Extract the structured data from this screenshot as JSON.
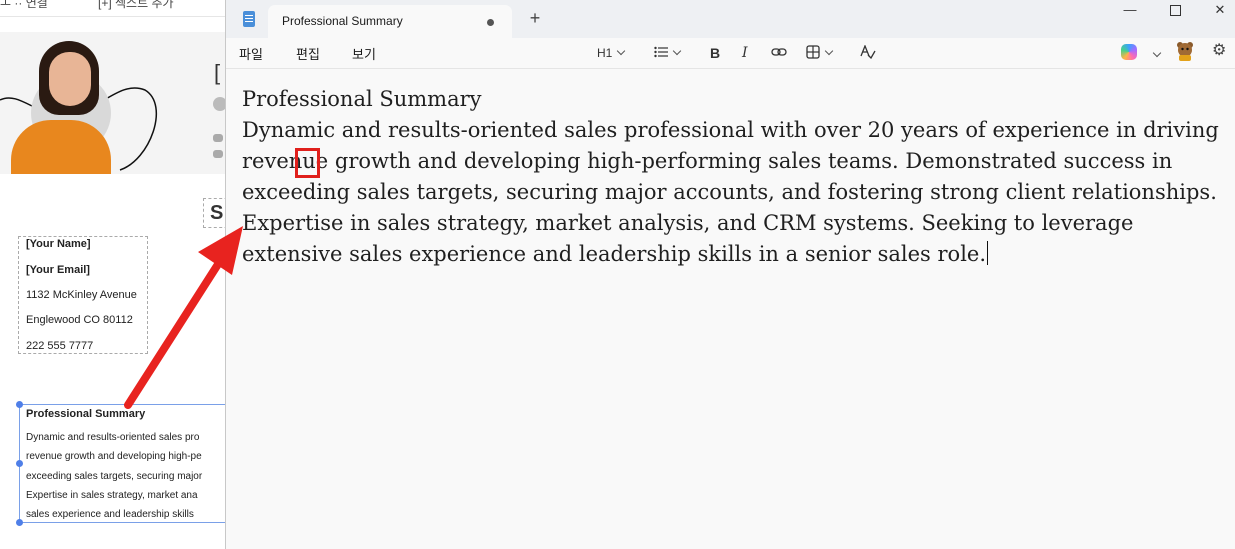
{
  "background_document": {
    "contact": {
      "name": "[Your Name]",
      "email": "[Your Email]",
      "address": "1132 McKinley Avenue",
      "city": "Englewood CO 80112",
      "phone": "222 555 7777"
    },
    "section_letter": "S",
    "header_bracket": "[",
    "summary_title": "Professional Summary",
    "summary_lines": [
      "Dynamic and results-oriented sales pro",
      "revenue growth and developing high-pe",
      "exceeding sales targets, securing major",
      "Expertise in sales strategy, market ana",
      "sales experience and leadership skills"
    ]
  },
  "window": {
    "tab_title": "Professional Summary",
    "new_tab_symbol": "+",
    "controls": {
      "minimize": "—",
      "close": "✕"
    },
    "menu": [
      "파일",
      "편집",
      "보기"
    ],
    "toolbar": {
      "heading": "H1",
      "icons": [
        "list-icon",
        "bold-icon",
        "italic-icon",
        "link-icon",
        "table-icon",
        "spellcheck-icon",
        "copilot-icon",
        "avatar-icon",
        "settings-icon"
      ],
      "bold_label": "B",
      "italic_label": "I",
      "spellcheck_label": "A͟ₒ"
    }
  },
  "document": {
    "title": "Professional Summary",
    "body": "Dynamic and results-oriented sales professional with over 20 years of experience in driving revenue growth and developing high-performing sales teams. Demonstrated success in exceeding sales targets, securing major accounts, and fostering strong client relationships. Expertise in sales strategy, market analysis, and CRM systems. Seeking to leverage extensive sales experience and leadership skills in a senior sales role."
  },
  "annotation": {
    "highlight_text": "ue",
    "arrow_color": "#e8231f",
    "box_color": "#e0201c"
  }
}
